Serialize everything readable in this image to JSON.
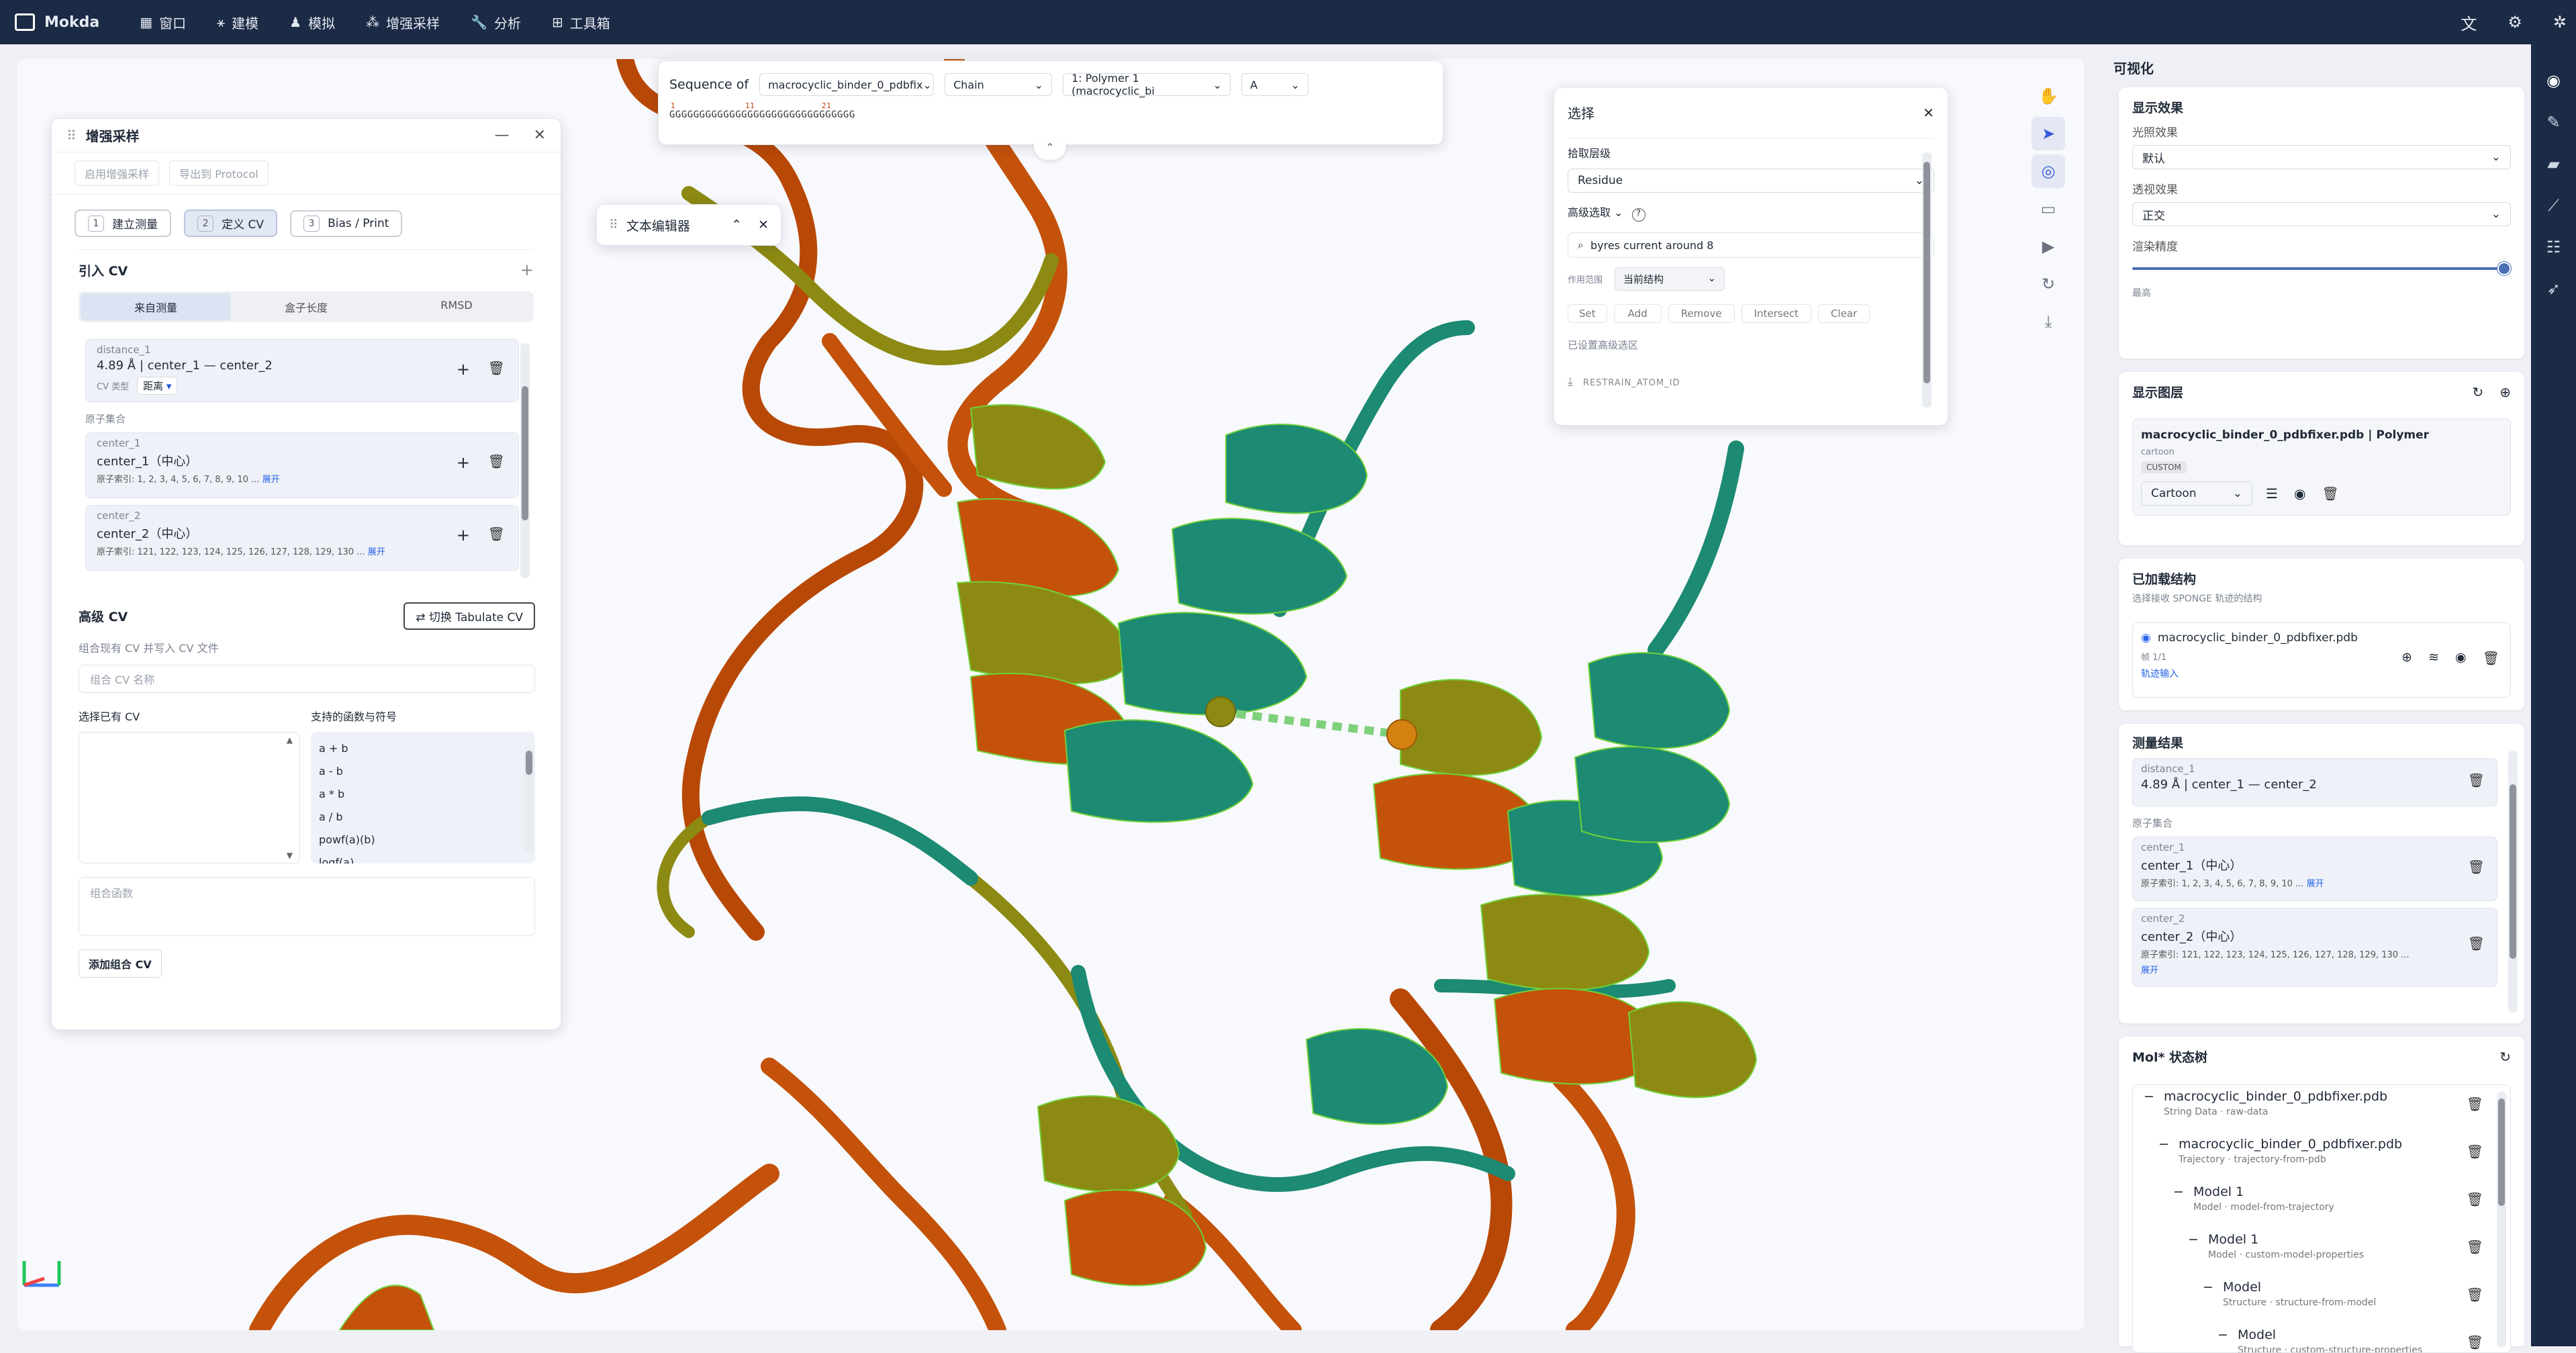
{
  "app": {
    "name": "Mokda"
  },
  "menu": [
    {
      "label": "窗口",
      "icon": "window-icon"
    },
    {
      "label": "建模",
      "icon": "model-icon"
    },
    {
      "label": "模拟",
      "icon": "simulate-icon"
    },
    {
      "label": "增强采样",
      "icon": "sampling-icon"
    },
    {
      "label": "分析",
      "icon": "wrench-icon"
    },
    {
      "label": "工具箱",
      "icon": "toolbox-icon"
    }
  ],
  "sequence": {
    "title": "Sequence of",
    "entity": "macrocyclic_binder_0_pdbfix",
    "mode": "Chain",
    "polymer": "1: Polymer 1 (macrocyclic_bi",
    "chain": "A",
    "residues": "GGGGGGGGGGGGGGGGGGGGGGGGGGGGGGG",
    "marks": [
      "1",
      "11",
      "21"
    ]
  },
  "text_editor": {
    "title": "文本编辑器"
  },
  "sampling": {
    "title": "增强采样",
    "top_buttons": [
      "启用增强采样",
      "导出到 Protocol"
    ],
    "steps": [
      {
        "n": "1",
        "label": "建立测量"
      },
      {
        "n": "2",
        "label": "定义 CV"
      },
      {
        "n": "3",
        "label": "Bias / Print"
      }
    ],
    "intro_title": "引入 CV",
    "tabs": [
      "来自测量",
      "盒子长度",
      "RMSD"
    ],
    "distance": {
      "name": "distance_1",
      "value": "4.89 Å | center_1 — center_2",
      "type_label": "CV 类型",
      "type_value": "距离"
    },
    "atom_set_label": "原子集合",
    "centers": [
      {
        "name": "center_1",
        "title": "center_1（中心）",
        "idx_label": "原子索引:",
        "idx": "1, 2, 3, 4, 5, 6, 7, 8, 9, 10 ...",
        "expand": "展开"
      },
      {
        "name": "center_2",
        "title": "center_2（中心）",
        "idx_label": "原子索引:",
        "idx": "121, 122, 123, 124, 125, 126, 127, 128, 129, 130 ...",
        "expand": "展开"
      }
    ],
    "advanced_title": "高级 CV",
    "advanced_hint": "组合现有 CV 并写入 CV 文件",
    "switch_button": "切换 Tabulate CV",
    "combo_name_placeholder": "组合 CV 名称",
    "choose_label": "选择已有 CV",
    "funcs_label": "支持的函数与符号",
    "funcs": [
      "a + b",
      "a - b",
      "a * b",
      "a / b",
      "powf(a)(b)",
      "logf(a)"
    ],
    "combo_func_placeholder": "组合函数",
    "add_button": "添加组合 CV"
  },
  "selection": {
    "title": "选择",
    "pick_label": "拾取层级",
    "pick_value": "Residue",
    "adv_label": "高级选取",
    "query": "byres current around 8",
    "scope_label": "作用范围",
    "scope_value": "当前结构",
    "ops": [
      "Set",
      "Add",
      "Remove",
      "Intersect",
      "Clear"
    ],
    "status": "已设置高级选区",
    "download": "RESTRAIN_ATOM_ID"
  },
  "right": {
    "title": "可视化",
    "display": {
      "title": "显示效果",
      "light_label": "光照效果",
      "light_value": "默认",
      "persp_label": "透视效果",
      "persp_value": "正交",
      "quality_label": "渲染精度",
      "quality_value": "最高",
      "quality_level": 1.0
    },
    "layers": {
      "title": "显示图层",
      "name": "macrocyclic_binder_0_pdbfixer.pdb | Polymer",
      "sub": "cartoon",
      "tag": "CUSTOM",
      "repr": "Cartoon"
    },
    "loaded": {
      "title": "已加载结构",
      "hint": "选择接收 SPONGE 轨迹的结构",
      "file": "macrocyclic_binder_0_pdbfixer.pdb",
      "frame": "帧 1/1",
      "traj": "轨迹输入"
    },
    "measure": {
      "title": "测量结果",
      "distance_name": "distance_1",
      "distance_value": "4.89 Å | center_1 — center_2",
      "atom_set_label": "原子集合",
      "centers": [
        {
          "name": "center_1",
          "title": "center_1（中心）",
          "idx_label": "原子索引:",
          "idx": "1, 2, 3, 4, 5, 6, 7, 8, 9, 10 ...",
          "expand": "展开"
        },
        {
          "name": "center_2",
          "title": "center_2（中心）",
          "idx_label": "原子索引:",
          "idx": "121, 122, 123, 124, 125, 126, 127, 128, 129, 130 ...",
          "expand": "展开"
        }
      ]
    },
    "tree": {
      "title": "Mol* 状态树",
      "nodes": [
        {
          "name": "macrocyclic_binder_0_pdbfixer.pdb",
          "kind": "String Data",
          "sub": "raw-data"
        },
        {
          "name": "macrocyclic_binder_0_pdbfixer.pdb",
          "kind": "Trajectory",
          "sub": "trajectory-from-pdb"
        },
        {
          "name": "Model 1",
          "kind": "Model",
          "sub": "model-from-trajectory"
        },
        {
          "name": "Model 1",
          "kind": "Model",
          "sub": "custom-model-properties"
        },
        {
          "name": "Model",
          "kind": "Structure",
          "sub": "structure-from-model"
        },
        {
          "name": "Model",
          "kind": "Structure",
          "sub": "custom-structure-properties"
        }
      ]
    }
  },
  "colors": {
    "topbar": "#1b2a45",
    "teal": "#1d8a73",
    "orange": "#c4520a",
    "olive": "#8c8a12",
    "accent": "#3b5bdb"
  }
}
